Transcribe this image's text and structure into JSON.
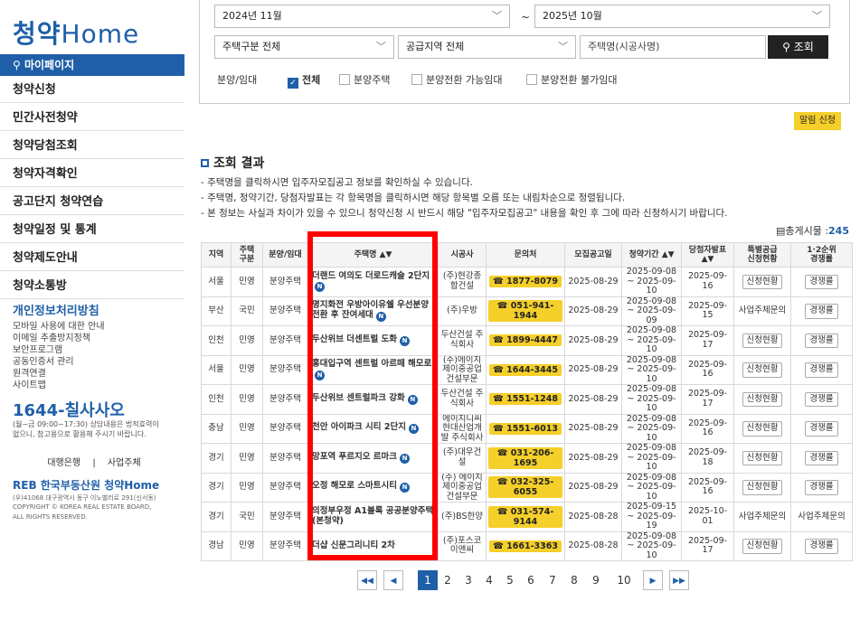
{
  "sidebar": {
    "logo_k": "청약",
    "logo_home": "Home",
    "mypage": "마이페이지",
    "menu": [
      "청약신청",
      "민간사전청약",
      "청약당첨조회",
      "청약자격확인",
      "공고단지 청약연습",
      "청약일정 및 통계",
      "청약제도안내",
      "청약소통방"
    ],
    "privacy_title": "개인정보처리방침",
    "links": [
      "모바일 사용에 대한 안내",
      "이메일 추출방지정책",
      "보안프로그램",
      "공동인증서 관리",
      "원격연결",
      "사이트맵"
    ],
    "call": "1644-칠사사오",
    "call_note1": "(월~금 09:00~17:30) 상담내용은 법적효력이",
    "call_note2": "없으니, 참고용으로 활용해 주시기 바랍니다.",
    "bank": "대행은행",
    "bank_sep": "|",
    "agency": "사업주체",
    "footer_logo": "REB 한국부동산원 청약Home",
    "foot1": "(우)41068 대구광역시 동구 이노밸리로 291(신서동)",
    "foot2": "COPYRIGHT © KOREA REAL ESTATE BOARD,",
    "foot3": "ALL RIGHTS RESERVED."
  },
  "search": {
    "date_from": "2024년 11월",
    "tilde": "~",
    "date_to": "2025년 10월",
    "house_type": "주택구분 전체",
    "region": "공급지역 전체",
    "name_placeholder": "주택명(시공사명)",
    "search_btn": "조회",
    "type_label": "분양/임대",
    "checks": [
      {
        "label": "전체",
        "checked": true
      },
      {
        "label": "분양주택",
        "checked": false
      },
      {
        "label": "분양전환 가능임대",
        "checked": false
      },
      {
        "label": "분양전환 불가임대",
        "checked": false
      }
    ]
  },
  "alert_btn": "알림 신청",
  "results": {
    "title": "조회 결과",
    "notes": [
      "- 주택명을 클릭하시면 입주자모집공고 정보를 확인하실 수 있습니다.",
      "- 주택명, 청약기간, 당첨자발표는 각 항목명을 클릭하시면 해당 항목별 오름 또는 내림차순으로 정렬됩니다.",
      "- 본 정보는 사실과 차이가 있을 수 있으니 청약신청 시 반드시 해당 \"입주자모집공고\" 내용을 확인 후 그에 따라 신청하시기 바랍니다."
    ],
    "total_label": "총게시물 :",
    "total_value": "245"
  },
  "table": {
    "headers": [
      "지역",
      "주택\n구분",
      "분양/임대",
      "주택명 ▲▼",
      "시공사",
      "문의처",
      "모집공고일",
      "청약기간 ▲▼",
      "당첨자발표\n▲▼",
      "특별공급\n신청현황",
      "1·2순위\n경쟁률"
    ],
    "rows": [
      {
        "region": "서울",
        "kind": "민영",
        "sale": "분양주택",
        "name": "더랜드 여의도 더로드캐슬 2단지",
        "badge": true,
        "builder": "(주)현강종합건설",
        "phone": "☎ 1877-8079",
        "notice": "2025-08-29",
        "period": "2025-09-08 ~ 2025-09-10",
        "winner": "2025-09-16",
        "special": "신청현황",
        "rank": "경쟁률"
      },
      {
        "region": "부산",
        "kind": "국민",
        "sale": "분양주택",
        "name": "명지화전 우방아이유쉘 우선분양전환 후 잔여세대",
        "badge": true,
        "builder": "(주)우방",
        "phone": "☎ 051-941-1944",
        "notice": "2025-08-29",
        "period": "2025-09-08 ~ 2025-09-09",
        "winner": "2025-09-15",
        "special": "사업주체문의",
        "rank": "경쟁률"
      },
      {
        "region": "인천",
        "kind": "민영",
        "sale": "분양주택",
        "name": "두산위브 더센트럴 도화",
        "badge": true,
        "builder": "두산건설 주식회사",
        "phone": "☎ 1899-4447",
        "notice": "2025-08-29",
        "period": "2025-09-08 ~ 2025-09-10",
        "winner": "2025-09-17",
        "special": "신청현황",
        "rank": "경쟁률"
      },
      {
        "region": "서울",
        "kind": "민영",
        "sale": "분양주택",
        "name": "홍대입구역 센트럴 아르떼 해모로",
        "badge": true,
        "builder": "(주)에이치제이중공업 건설부문",
        "phone": "☎ 1644-3445",
        "notice": "2025-08-29",
        "period": "2025-09-08 ~ 2025-09-10",
        "winner": "2025-09-16",
        "special": "신청현황",
        "rank": "경쟁률"
      },
      {
        "region": "인천",
        "kind": "민영",
        "sale": "분양주택",
        "name": "두산위브 센트럴파크 강화",
        "badge": true,
        "builder": "두산건설 주식회사",
        "phone": "☎ 1551-1248",
        "notice": "2025-08-29",
        "period": "2025-09-08 ~ 2025-09-10",
        "winner": "2025-09-17",
        "special": "신청현황",
        "rank": "경쟁률"
      },
      {
        "region": "충남",
        "kind": "민영",
        "sale": "분양주택",
        "name": "천안 아이파크 시티 2단지",
        "badge": true,
        "builder": "에이치디씨현대산업개발 주식회사",
        "phone": "☎ 1551-6013",
        "notice": "2025-08-29",
        "period": "2025-09-08 ~ 2025-09-10",
        "winner": "2025-09-16",
        "special": "신청현황",
        "rank": "경쟁률"
      },
      {
        "region": "경기",
        "kind": "민영",
        "sale": "분양주택",
        "name": "망포역 푸르지오 르마크",
        "badge": true,
        "builder": "(주)대우건설",
        "phone": "☎ 031-206-1695",
        "notice": "2025-08-29",
        "period": "2025-09-08 ~ 2025-09-10",
        "winner": "2025-09-18",
        "special": "신청현황",
        "rank": "경쟁률"
      },
      {
        "region": "경기",
        "kind": "민영",
        "sale": "분양주택",
        "name": "오정 해모로 스마트시티",
        "badge": true,
        "builder": "(주) 에이치제이중공업 건설부문",
        "phone": "☎ 032-325-6055",
        "notice": "2025-08-29",
        "period": "2025-09-08 ~ 2025-09-10",
        "winner": "2025-09-16",
        "special": "신청현황",
        "rank": "경쟁률"
      },
      {
        "region": "경기",
        "kind": "국민",
        "sale": "분양주택",
        "name": "의정부우정 A1블록 공공분양주택(본청약)",
        "badge": false,
        "builder": "(주)BS한양",
        "phone": "☎ 031-574-9144",
        "notice": "2025-08-28",
        "period": "2025-09-15 ~ 2025-09-19",
        "winner": "2025-10-01",
        "special": "사업주체문의",
        "rank": "사업주체문의"
      },
      {
        "region": "경남",
        "kind": "민영",
        "sale": "분양주택",
        "name": "더샵 신문그리니티 2차",
        "badge": false,
        "builder": "(주)포스코이앤씨",
        "phone": "☎ 1661-3363",
        "notice": "2025-08-28",
        "period": "2025-09-08 ~ 2025-09-10",
        "winner": "2025-09-17",
        "special": "신청현황",
        "rank": "경쟁률"
      }
    ]
  },
  "pager": {
    "first": "◀◀",
    "prev": "◀",
    "pages": [
      "1",
      "2",
      "3",
      "4",
      "5",
      "6",
      "7",
      "8",
      "9",
      "10"
    ],
    "current": "1",
    "next": "▶",
    "last": "▶▶"
  },
  "colors": {
    "accent": "#1f5fa8",
    "highlight": "#ff0000",
    "phone_bg": "#f5cf2a"
  }
}
